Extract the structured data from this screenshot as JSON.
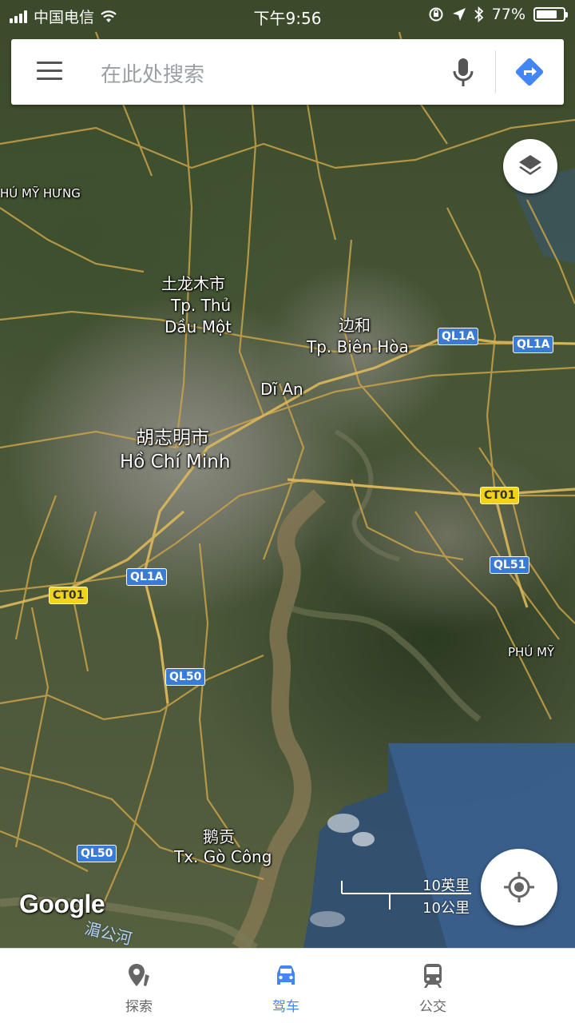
{
  "status_bar": {
    "carrier": "中国电信",
    "time": "下午9:56",
    "battery_pct": "77%",
    "icons": [
      "signal-icon",
      "wifi-icon",
      "orientation-lock-icon",
      "location-arrow-icon",
      "bluetooth-icon",
      "battery-icon"
    ]
  },
  "search": {
    "placeholder": "在此处搜索"
  },
  "map": {
    "labels": {
      "phu_my_hung": "HÚ MỸ HƯNG",
      "thu_dau_mot_cn": "土龙木市",
      "thu_dau_mot_vn1": "Tp. Thủ",
      "thu_dau_mot_vn2": "Dầu Một",
      "bien_hoa_cn": "边和",
      "bien_hoa_vn": "Tp. Biên Hòa",
      "di_an": "Dĩ An",
      "hcm_cn": "胡志明市",
      "hcm_vn": "Hồ Chí Minh",
      "phu_my": "PHÚ MỸ",
      "go_cong_cn": "鹅贡",
      "go_cong_vn": "Tx. Gò Công",
      "river": "湄公河"
    },
    "shields": {
      "ql1a_a": "QL1A",
      "ql1a_b": "QL1A",
      "ql1a_c": "QL1A",
      "ct01_a": "CT01",
      "ct01_b": "CT01",
      "ql51": "QL51",
      "ql50_a": "QL50",
      "ql50_b": "QL50"
    },
    "attribution": "Google",
    "scale_imperial": "10英里",
    "scale_metric": "10公里"
  },
  "bottom_nav": {
    "items": [
      {
        "label": "探索",
        "icon": "explore-pin-icon",
        "active": false
      },
      {
        "label": "驾车",
        "icon": "car-icon",
        "active": true
      },
      {
        "label": "公交",
        "icon": "train-icon",
        "active": false
      }
    ]
  },
  "colors": {
    "accent": "#4285f4",
    "road": "#c8a24a",
    "shield_blue": "#3a7bd5",
    "shield_yellow": "#f2d31b"
  }
}
